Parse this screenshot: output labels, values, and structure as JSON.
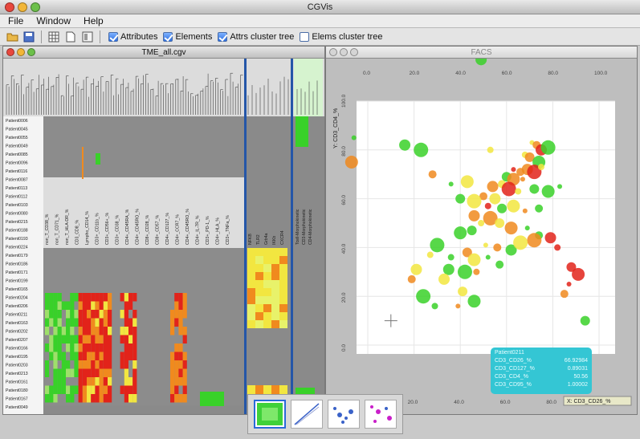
{
  "app": {
    "title": "CGVis"
  },
  "menu": [
    "File",
    "Window",
    "Help"
  ],
  "toolbar": {
    "checks": [
      {
        "label": "Attributes",
        "checked": true
      },
      {
        "label": "Elements",
        "checked": true
      },
      {
        "label": "Attrs cluster tree",
        "checked": true
      },
      {
        "label": "Elems cluster tree",
        "checked": false
      }
    ]
  },
  "heatmap_window": {
    "title": "TME_all.cgv",
    "rows": [
      "Patient0006",
      "Patient0045",
      "Patient0055",
      "Patient0049",
      "Patient0085",
      "Patient0096",
      "Patient0116",
      "Patient0087",
      "Patient0113",
      "Patient0112",
      "Patient0103",
      "Patient0080",
      "Patient0215",
      "Patient0188",
      "Patient0193",
      "Patient0224",
      "Patient0179",
      "Patient0186",
      "Patient0171",
      "Patient0199",
      "Patient0165",
      "Patient0204",
      "Patient0206",
      "Patient0211",
      "Patient0163",
      "Patient0202",
      "Patient0207",
      "Patient0166",
      "Patient0195",
      "Patient0203",
      "Patient0213",
      "Patient0161",
      "Patient0180",
      "Patient0167",
      "Patient0049"
    ],
    "columns": [
      "non_T_CD38_%",
      "non_T_CD71_%",
      "non_T_HLA-DR_%",
      "CD3_CD8_%",
      "Lympho_CD14_%",
      "CD3+_CD11b_%",
      "CD3+_CD56+_%",
      "CD3+_CD38_%",
      "CD4+_CD45RA_%",
      "CD4+_CD45RO_%",
      "CD8+_CD28_%",
      "CD8+_CD57_%",
      "CD4+_CD127_%",
      "CD4+_CCR7_%",
      "CD4+_CD45RO_%",
      "CD4+_IL-7R_%",
      "CD3+_PD-1_%",
      "CD4+_HLA_%",
      "CD3+_TNFa_%"
    ],
    "columns_mid": [
      "NFKB",
      "TLR2",
      "Grb4a",
      "IKKb",
      "CXCR4"
    ],
    "columns_right": [
      "Tcell-Morphokinetic",
      "CD3-Morphokinetic",
      "CD4-Morphokinetic"
    ]
  },
  "scatter_window": {
    "title": "FACS",
    "x_label": "X: CD3_CD26_%",
    "y_label": "Y: CD3_CD4_%",
    "x_ticks_top": [
      "0.0",
      "20.0",
      "40.0",
      "60.0",
      "80.0",
      "100.0"
    ],
    "x_ticks_bottom": [
      "20.0",
      "40.0",
      "60.0",
      "80.0",
      "100.0"
    ],
    "y_ticks": [
      "0.0",
      "20.0",
      "40.0",
      "60.0",
      "80.0",
      "100.0"
    ]
  },
  "tooltip": {
    "title": "Patient0211",
    "rows": [
      {
        "label": "CD3_CD26_%",
        "value": "66.92984"
      },
      {
        "label": "CD3_CD127_%",
        "value": "0.89031"
      },
      {
        "label": "CD3_CD4_%",
        "value": "50.56"
      },
      {
        "label": "CD3_CD95_%",
        "value": "1.00002"
      }
    ]
  },
  "colors": {
    "green": "#39d129",
    "yellow": "#f2e640",
    "orange": "#f08a1e",
    "red": "#e2231a",
    "tooltip": "#34c6d4",
    "divider": "#2456a8"
  },
  "chart_data": {
    "type": "scatter",
    "xlabel": "X: CD3_CD26_%",
    "ylabel": "Y: CD3_CD4_%",
    "xlim": [
      0,
      100
    ],
    "ylim": [
      0,
      100
    ],
    "points": [
      [
        71,
        83,
        "yellow"
      ],
      [
        73,
        82,
        "orange"
      ],
      [
        75,
        80,
        "red"
      ],
      [
        78,
        81,
        "green"
      ],
      [
        68,
        78,
        "yellow"
      ],
      [
        70,
        77,
        "orange"
      ],
      [
        74,
        75,
        "green"
      ],
      [
        63,
        72,
        "red"
      ],
      [
        66,
        71,
        "orange"
      ],
      [
        69,
        72,
        "orange"
      ],
      [
        72,
        71,
        "red"
      ],
      [
        75,
        73,
        "yellow"
      ],
      [
        60,
        69,
        "green"
      ],
      [
        63,
        68,
        "orange"
      ],
      [
        67,
        68,
        "orange"
      ],
      [
        58,
        66,
        "yellow"
      ],
      [
        54,
        65,
        "orange"
      ],
      [
        61,
        64,
        "red"
      ],
      [
        65,
        63,
        "yellow"
      ],
      [
        72,
        64,
        "green"
      ],
      [
        78,
        63,
        "green"
      ],
      [
        83,
        65,
        "green"
      ],
      [
        50,
        61,
        "orange"
      ],
      [
        55,
        60,
        "yellow"
      ],
      [
        46,
        59,
        "yellow"
      ],
      [
        52,
        57,
        "red"
      ],
      [
        58,
        56,
        "green"
      ],
      [
        63,
        57,
        "yellow"
      ],
      [
        68,
        55,
        "orange"
      ],
      [
        74,
        56,
        "green"
      ],
      [
        46,
        53,
        "orange"
      ],
      [
        53,
        52,
        "orange"
      ],
      [
        49,
        50,
        "yellow"
      ],
      [
        57,
        50,
        "yellow"
      ],
      [
        62,
        48,
        "orange"
      ],
      [
        69,
        48,
        "green"
      ],
      [
        74,
        45,
        "green"
      ],
      [
        79,
        44,
        "red"
      ],
      [
        72,
        43,
        "orange"
      ],
      [
        82,
        40,
        "red"
      ],
      [
        45,
        47,
        "green"
      ],
      [
        40,
        46,
        "green"
      ],
      [
        51,
        41,
        "yellow"
      ],
      [
        56,
        40,
        "orange"
      ],
      [
        62,
        39,
        "green"
      ],
      [
        66,
        42,
        "yellow"
      ],
      [
        36,
        36,
        "green"
      ],
      [
        43,
        38,
        "orange"
      ],
      [
        46,
        35,
        "yellow"
      ],
      [
        52,
        36,
        "green"
      ],
      [
        57,
        33,
        "green"
      ],
      [
        35,
        31,
        "green"
      ],
      [
        42,
        30,
        "green"
      ],
      [
        47,
        30,
        "orange"
      ],
      [
        88,
        32,
        "red"
      ],
      [
        91,
        29,
        "red"
      ],
      [
        87,
        25,
        "red"
      ],
      [
        85,
        21,
        "orange"
      ],
      [
        33,
        27,
        "yellow"
      ],
      [
        24,
        20,
        "green"
      ],
      [
        29,
        16,
        "green"
      ],
      [
        41,
        22,
        "yellow"
      ],
      [
        46,
        18,
        "green"
      ],
      [
        39,
        16,
        "orange"
      ],
      [
        19,
        27,
        "orange"
      ],
      [
        21,
        31,
        "yellow"
      ],
      [
        30,
        41,
        "green"
      ],
      [
        27,
        37,
        "yellow"
      ],
      [
        40,
        60,
        "green"
      ],
      [
        43,
        67,
        "yellow"
      ],
      [
        36,
        66,
        "green"
      ],
      [
        28,
        70,
        "orange"
      ],
      [
        16,
        82,
        "green"
      ],
      [
        23,
        80,
        "green"
      ],
      [
        53,
        80,
        "yellow"
      ],
      [
        94,
        10,
        "green"
      ],
      [
        -7,
        75,
        "orange"
      ],
      [
        -6,
        85,
        "green"
      ],
      [
        -3,
        122,
        "black"
      ],
      [
        49,
        117,
        "green"
      ]
    ]
  }
}
